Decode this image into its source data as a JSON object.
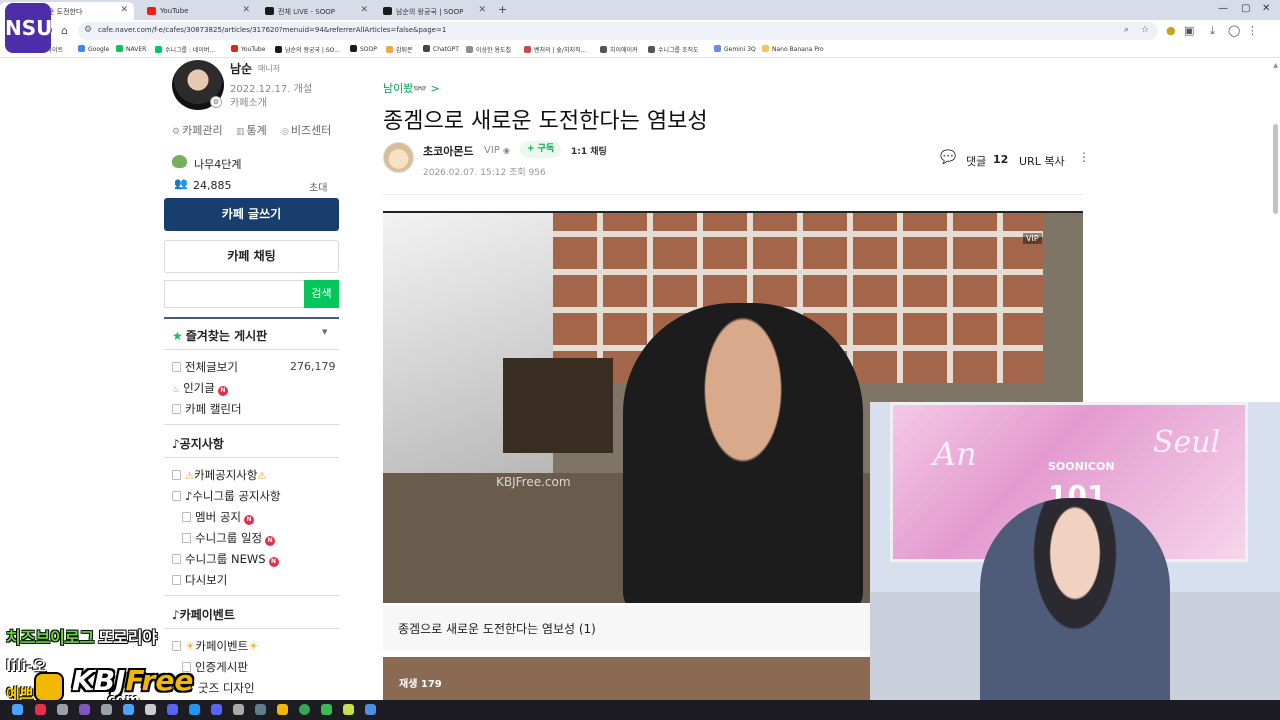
{
  "tabs": [
    {
      "label": "으로 새로운 도전한다",
      "active": true
    },
    {
      "label": "YouTube",
      "active": false
    },
    {
      "label": "전체 LIVE - SOOP",
      "active": false
    },
    {
      "label": "남순의 왕궁국 | SOOP",
      "active": false
    }
  ],
  "window": {
    "minimize": "—",
    "maximize": "▢",
    "close": "✕"
  },
  "address": {
    "url": "cafe.naver.com/f-e/cafes/30873825/articles/317620?menuid=94&referrerAllArticles=false&page=1"
  },
  "bookmarks": [
    "인용어사이트",
    "Google",
    "NAVER",
    "수니그룹 : 네이버...",
    "YouTube",
    "남순의 왕궁국 | SO...",
    "SOOP",
    "감튀몬",
    "ChatGPT",
    "이상한 용도칩",
    "벤처의 | 숲/치지직...",
    "치이에이커",
    "수니그룹 조직도",
    "Gemini 3Q",
    "Nano Banana Pro"
  ],
  "sidebar": {
    "manager_name": "남순",
    "manager_role": "매니저",
    "founded": "2022.12.17. 개설",
    "intro_link": "카페소개",
    "links": [
      "카페관리",
      "통계",
      "비즈센터"
    ],
    "level": "나무4단계",
    "members": "24,885",
    "invite": "초대",
    "write_button": "카페 글쓰기",
    "chat_button": "카페 채팅",
    "search_button": "검색",
    "favorites_title": "즐겨찾는 게시판",
    "favorites": [
      {
        "label": "전체글보기",
        "count": "276,179",
        "new": ""
      },
      {
        "label": "인기글",
        "count": "",
        "new": "N"
      },
      {
        "label": "카페 캘린더",
        "count": "",
        "new": ""
      }
    ],
    "notice_title": "♪공지사항",
    "notices": [
      {
        "label": "카페공지사항",
        "new": ""
      },
      {
        "label": "♪수니그룹 공지사항",
        "new": ""
      },
      {
        "label": "멤버 공지",
        "new": "N"
      },
      {
        "label": "수니그룹 일정",
        "new": "N"
      },
      {
        "label": "수니그룹 NEWS",
        "new": "N"
      },
      {
        "label": "다시보기",
        "new": ""
      }
    ],
    "event_title": "♪카페이벤트",
    "events": [
      {
        "label": "카페이벤트"
      },
      {
        "label": "인증게시판"
      },
      {
        "label": "굿즈 디자인"
      }
    ]
  },
  "article": {
    "breadcrumb": "남이봤👓 >",
    "title": "종겜으로 새로운 도전한다는 염보성",
    "author": "초코아몬드",
    "grade": "VIP",
    "subscribe": "+ 구독",
    "chat": "1:1 채팅",
    "date": "2026.02.07. 15:12",
    "views": "조회 956",
    "comment_label": "댓글",
    "comment_count": "12",
    "url_copy": "URL 복사",
    "video_watermark": "KBJFree.com",
    "video_tag": "VIP",
    "caption": "종겜으로 새로운 도전한다는 염보성 (1)",
    "play_count": "재생 179"
  },
  "overlay": {
    "logo": "NSU",
    "line1a": "치즈브이로그",
    "line1b": "또로리야",
    "line2": "lili-오",
    "line3": "예쁘다",
    "kbj_a": "KBJ",
    "kbj_b": "Free",
    "kbj_com": ".com",
    "cam_logo_small": "SOONICON",
    "cam_logo_big": "101",
    "cam_script_a": "An",
    "cam_script_b": "Seul"
  },
  "colors": {
    "accent": "#03c75a",
    "write_button": "#173e6d",
    "new_badge": "#e5304a"
  }
}
